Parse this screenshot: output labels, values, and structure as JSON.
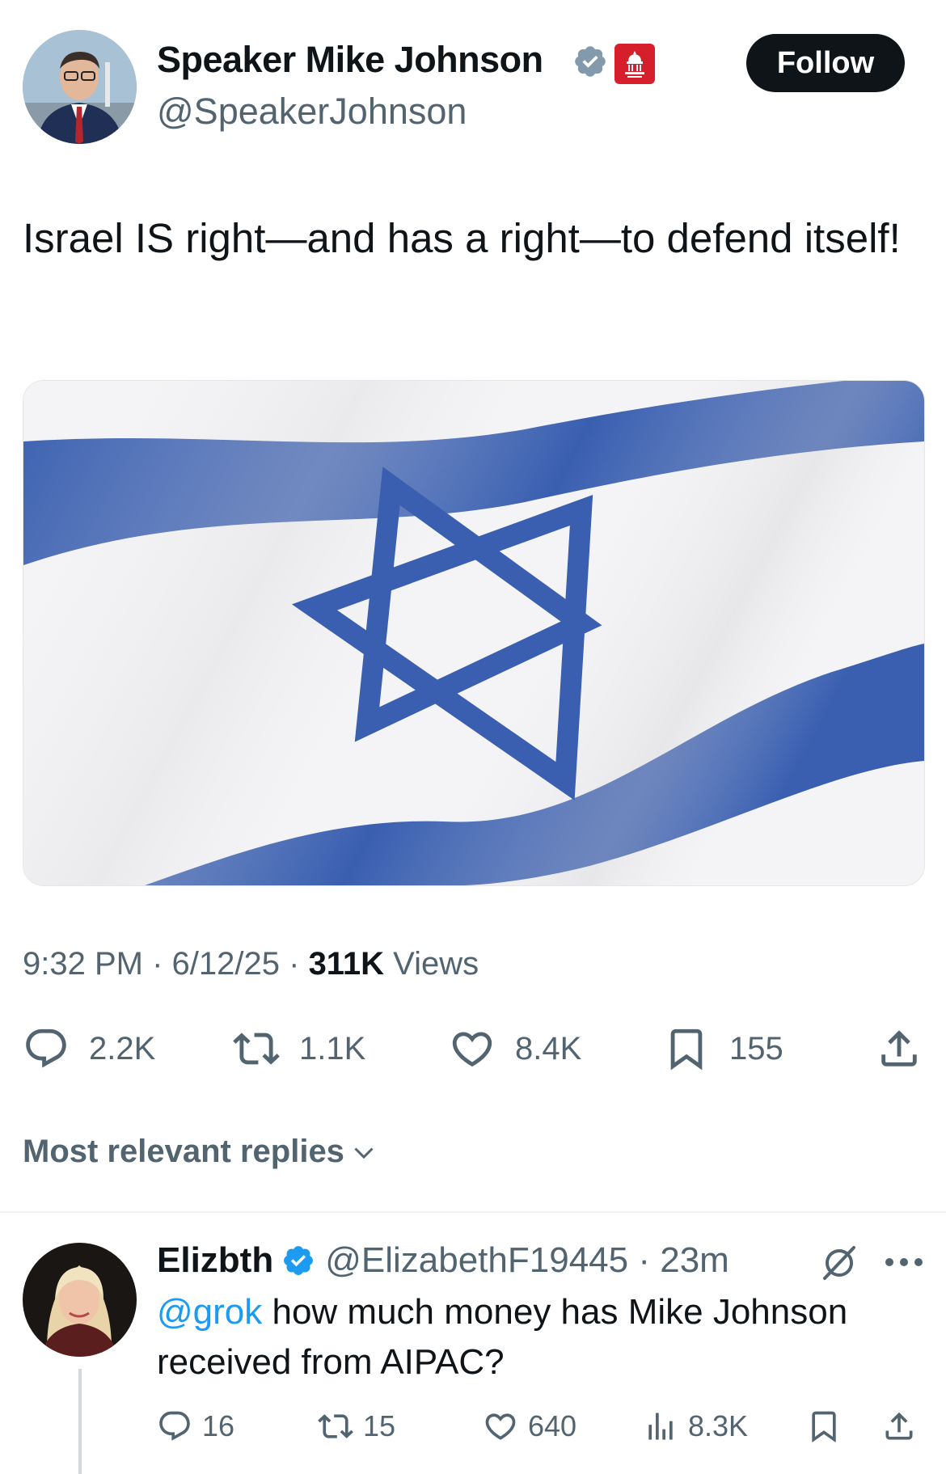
{
  "author": {
    "name": "Speaker Mike Johnson",
    "handle": "@SpeakerJohnson",
    "follow_label": "Follow"
  },
  "tweet": {
    "text": "Israel IS right—and has a right—to defend itself!",
    "time": "9:32 PM",
    "date": "6/12/25",
    "views_count": "311K",
    "views_label": "Views",
    "replies": "2.2K",
    "reposts": "1.1K",
    "likes": "8.4K",
    "bookmarks": "155"
  },
  "replies_section": {
    "sort_label": "Most relevant replies"
  },
  "reply": {
    "name": "Elizbth",
    "handle": "@ElizabethF19445",
    "time": "23m",
    "mention": "@grok",
    "text": " how much money has Mike Johnson received from AIPAC?",
    "replies": "16",
    "reposts": "15",
    "likes": "640",
    "views": "8.3K"
  },
  "colors": {
    "accent": "#1d9bf0",
    "flag_blue": "#3a5fb0",
    "gov_badge": "#d51f2a",
    "follow_bg": "#0f1419"
  },
  "icons": [
    "verified-grey-icon",
    "government-badge-icon",
    "reply-icon",
    "repost-icon",
    "like-icon",
    "bookmark-icon",
    "share-icon",
    "chevron-down-icon",
    "verified-blue-icon",
    "grok-icon",
    "more-icon",
    "views-icon"
  ]
}
